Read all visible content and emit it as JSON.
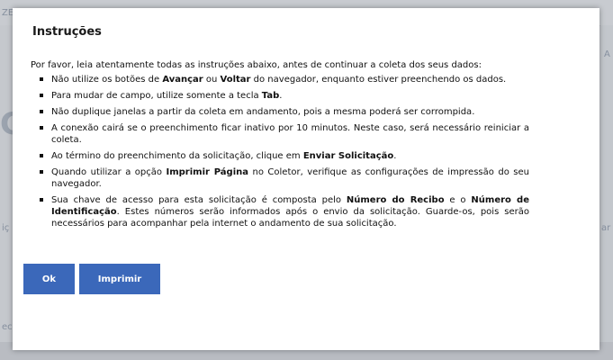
{
  "dialog": {
    "title": "Instruções",
    "intro": "Por favor, leia atentamente todas as instruções abaixo, antes de continuar a coleta dos seus dados:",
    "items": [
      [
        {
          "t": "Não utilize os botões de "
        },
        {
          "t": "Avançar",
          "b": true
        },
        {
          "t": " ou "
        },
        {
          "t": "Voltar",
          "b": true
        },
        {
          "t": " do navegador, enquanto estiver preenchendo os dados."
        }
      ],
      [
        {
          "t": "Para mudar de campo, utilize somente a tecla "
        },
        {
          "t": "Tab",
          "b": true
        },
        {
          "t": "."
        }
      ],
      [
        {
          "t": "Não duplique janelas a partir da coleta em andamento, pois a mesma poderá ser corrompida."
        }
      ],
      [
        {
          "t": "A conexão cairá se o preenchimento ficar inativo por 10 minutos. Neste caso, será necessário reiniciar a coleta."
        }
      ],
      [
        {
          "t": "Ao término do preenchimento da solicitação, clique em "
        },
        {
          "t": "Enviar Solicitação",
          "b": true
        },
        {
          "t": "."
        }
      ],
      [
        {
          "t": "Quando utilizar a opção "
        },
        {
          "t": "Imprimir Página",
          "b": true
        },
        {
          "t": " no Coletor, verifique as configurações de impressão do seu navegador."
        }
      ],
      [
        {
          "t": "Sua chave de acesso para esta solicitação é composta pelo "
        },
        {
          "t": "Número do Recibo",
          "b": true
        },
        {
          "t": " e o "
        },
        {
          "t": "Número de Identificação",
          "b": true
        },
        {
          "t": ". Estes números serão informados após o envio da solicitação. Guarde-os, pois serão necessários para acompanhar pela internet o andamento de sua solicitação."
        }
      ]
    ],
    "buttons": {
      "ok": "Ok",
      "print": "Imprimir"
    }
  },
  "background": {
    "top_left_fragment": "ZE",
    "right_fragment": "A",
    "left_big_fragment": "C",
    "left_small_fragment_1": "iç",
    "left_small_fragment_2": "ec",
    "right_small_fragment": "ar"
  },
  "colors": {
    "button": "#3b68ba",
    "dialog_bg": "#ffffff",
    "text": "#111111"
  }
}
